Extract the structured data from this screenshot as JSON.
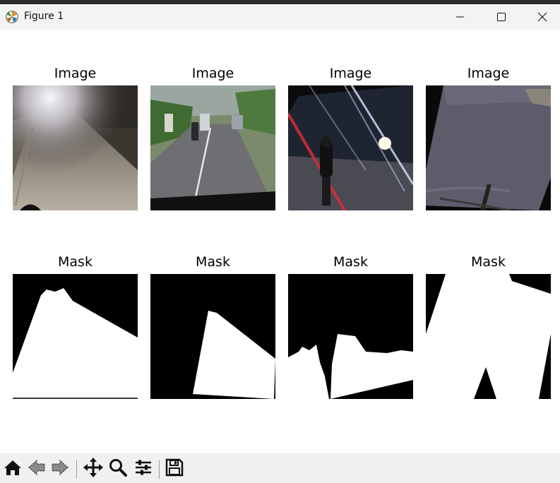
{
  "window": {
    "title": "Figure 1",
    "app_icon": "matplotlib-logo-icon",
    "controls": [
      "minimize-icon",
      "maximize-icon",
      "close-icon"
    ]
  },
  "figure": {
    "image_titles": [
      "Image",
      "Image",
      "Image",
      "Image"
    ],
    "mask_titles": [
      "Mask",
      "Mask",
      "Mask",
      "Mask"
    ]
  },
  "toolbar": {
    "icons": [
      "home-icon",
      "back-arrow-icon",
      "forward-arrow-icon",
      "pan-move-icon",
      "zoom-magnifier-icon",
      "configure-subplots-icon",
      "save-icon"
    ]
  },
  "colors": {
    "titlebar": "#f3f3f3",
    "toolbar": "#f0f0f0",
    "mask_background": "#000000",
    "mask_foreground": "#ffffff"
  }
}
